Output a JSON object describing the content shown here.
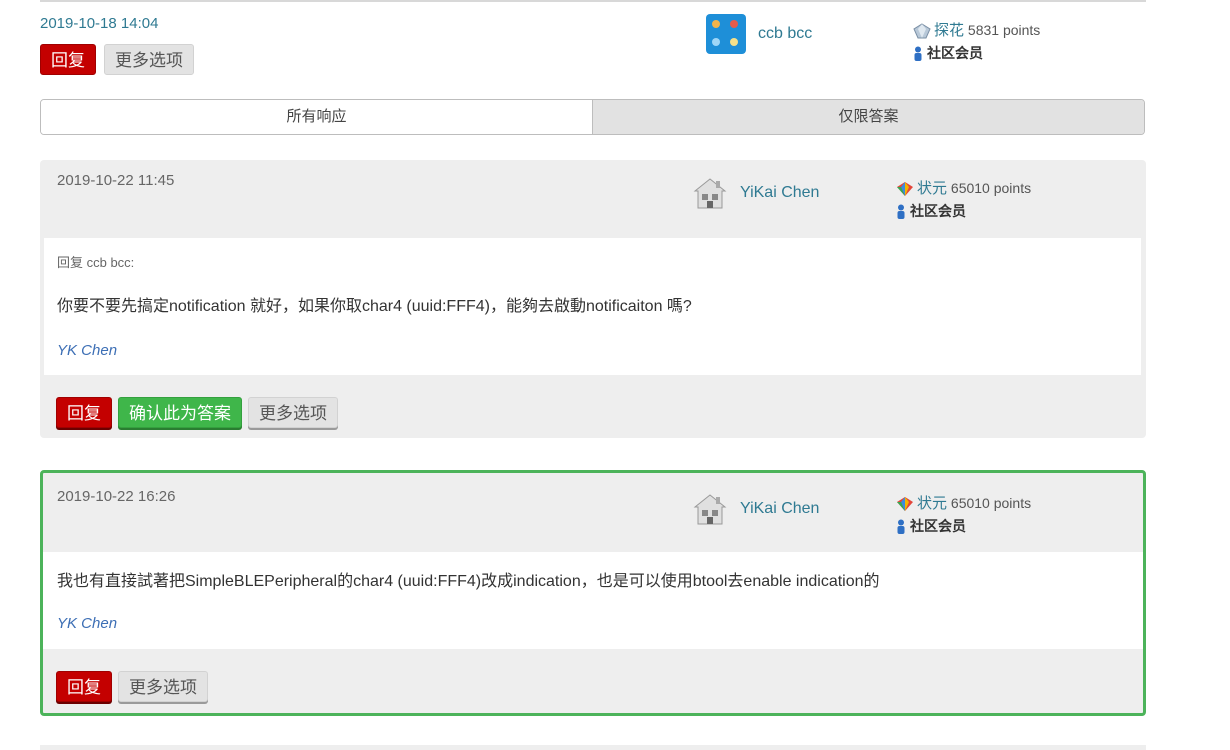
{
  "question": {
    "date": "2019-10-18 14:04",
    "reply_label": "回复",
    "more_label": "更多选项",
    "user": {
      "name": "ccb bcc",
      "rank": "探花",
      "points": "5831 points",
      "role": "社区会员"
    }
  },
  "tabs": [
    {
      "label": "所有响应",
      "active": true
    },
    {
      "label": "仅限答案",
      "active": false
    }
  ],
  "replies": [
    {
      "date": "2019-10-22 11:45",
      "user": {
        "name": "YiKai Chen",
        "rank": "状元",
        "points": "65010 points",
        "role": "社区会员"
      },
      "reply_to": "回复 ccb bcc:",
      "content": "你要不要先搞定notification 就好，如果你取char4 (uuid:FFF4)，能夠去啟動notificaiton 嗎?",
      "signature": "YK Chen",
      "reply_label": "回复",
      "accept_label": "确认此为答案",
      "more_label": "更多选项"
    },
    {
      "date": "2019-10-22 16:26",
      "accepted": true,
      "accent_color": "#4cb35a",
      "user": {
        "name": "YiKai Chen",
        "rank": "状元",
        "points": "65010 points",
        "role": "社区会员"
      },
      "content": "我也有直接試著把SimpleBLEPeripheral的char4 (uuid:FFF4)改成indication，也是可以使用btool去enable indication的",
      "signature": "YK Chen",
      "reply_label": "回复",
      "more_label": "更多选项"
    }
  ]
}
